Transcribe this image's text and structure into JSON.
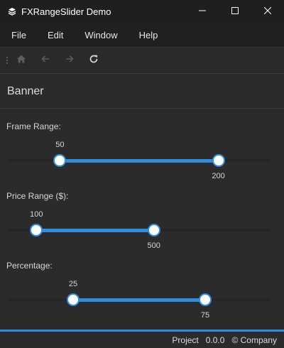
{
  "window": {
    "title": "FXRangeSlider Demo",
    "icon": "layers-icon"
  },
  "menu": {
    "items": [
      "File",
      "Edit",
      "Window",
      "Help"
    ]
  },
  "toolbar": {
    "buttons": [
      "home-icon",
      "back-arrow-icon",
      "forward-arrow-icon",
      "refresh-icon"
    ]
  },
  "banner": {
    "title": "Banner"
  },
  "sliders": [
    {
      "label": "Frame Range:",
      "min": 0,
      "max": 250,
      "low": 50,
      "high": 200,
      "low_label": "50",
      "high_label": "200"
    },
    {
      "label": "Price Range ($):",
      "min": 0,
      "max": 900,
      "low": 100,
      "high": 500,
      "low_label": "100",
      "high_label": "500"
    },
    {
      "label": "Percentage:",
      "min": 0,
      "max": 100,
      "low": 25,
      "high": 75,
      "low_label": "25",
      "high_label": "75"
    }
  ],
  "status": {
    "project": "Project",
    "version": "0.0.0",
    "company": "© Company"
  },
  "colors": {
    "accent": "#2f8de0",
    "background": "#2b2b2b",
    "titlebar": "#1f1f1f"
  }
}
